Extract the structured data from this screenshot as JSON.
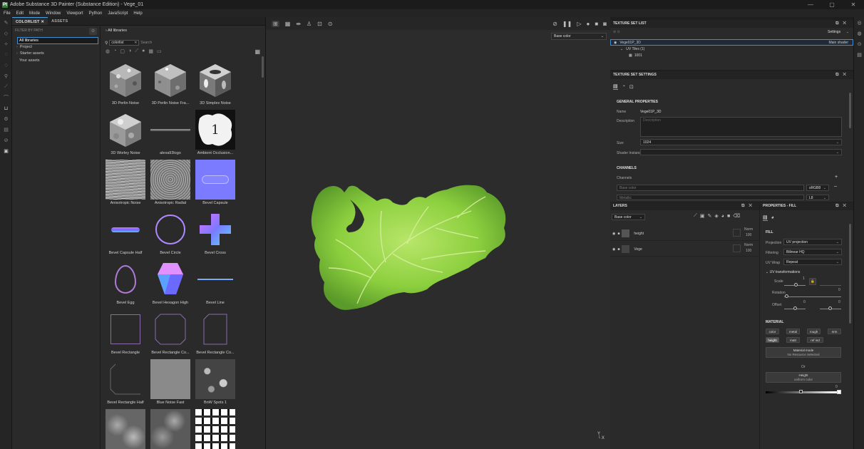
{
  "window": {
    "title": "Adobe Substance 3D Painter (Substance Edition) - Vege_01",
    "logo": "Pt",
    "controls": [
      "—",
      "▢",
      "✕"
    ]
  },
  "menu": [
    "File",
    "Edit",
    "Mode",
    "Window",
    "Viewport",
    "Python",
    "JavaScript",
    "Help"
  ],
  "shelf": {
    "tabs": [
      "COLORLIST",
      "ASSETS"
    ],
    "tab_close": "✕",
    "filter_header": "FILTER BY PATH",
    "paths": [
      {
        "label": "All libraries",
        "selected": true
      },
      {
        "label": "Project",
        "caret": "›"
      },
      {
        "label": "Starter assets",
        "caret": "›"
      },
      {
        "label": "Your assets"
      }
    ],
    "breadcrumb": "All libraries",
    "search_value": "colorlist",
    "search_placeholder": "Search",
    "assets": [
      "3D Perlin Noise",
      "3D Perlin Noise Fra...",
      "3D Simplex Noise",
      "3D Worley Noise",
      "alexa93logo",
      "Ambient Occlusion...",
      "Anisotropic Noise",
      "Anisotropic Radial",
      "Bevel Capsule",
      "Bevel Capsule Half",
      "Bevel Circle",
      "Bevel Cross",
      "Bevel Egg",
      "Bevel Hexagon High",
      "Bevel Line",
      "Bevel Rectangle",
      "Bevel Rectangle Co...",
      "Bevel Rectangle Co...",
      "Bevel Rectangle Half",
      "Blue Noise Fast",
      "BnW Spots 1",
      "",
      "",
      ""
    ]
  },
  "viewport": {
    "channel": "Base color",
    "axis": "Y\nZ —X"
  },
  "texture_set_list": {
    "header": "TEXTURE SET LIST",
    "settings": "Settings",
    "set_name": "Vege01P_3D",
    "shader": "Main shader",
    "uv_tiles": "UV Tiles (1)",
    "tile": "1001"
  },
  "texture_set_settings": {
    "header": "TEXTURE SET SETTINGS",
    "general": "GENERAL PROPERTIES",
    "name_label": "Name",
    "name_value": "Vege01P_3D",
    "desc_label": "Description",
    "desc_placeholder": "Description",
    "size_label": "Size",
    "size_value": "1024",
    "shader_label": "Shader Instance",
    "channels": "CHANNELS",
    "channels_label": "Channels",
    "ch1": "Base color",
    "ch1_fmt": "sRGB8",
    "ch2": "Metallic",
    "ch2_fmt": "L8"
  },
  "layers": {
    "header": "LAYERS",
    "channel": "Base color",
    "items": [
      {
        "name": "height",
        "blend": "Norm",
        "opacity": "100"
      },
      {
        "name": "Vege",
        "blend": "Norm",
        "opacity": "100"
      }
    ]
  },
  "properties": {
    "header": "PROPERTIES - FILL",
    "fill": "FILL",
    "projection_label": "Projection",
    "projection": "UV projection",
    "filtering_label": "Filtering",
    "filtering": "Bilinear HQ",
    "uvwrap_label": "UV Wrap",
    "uvwrap": "Repeat",
    "uvtrans": "UV transformations",
    "scale_label": "Scale",
    "scale_val": "1",
    "rotation_label": "Rotation",
    "rotation_val": "0",
    "offset_label": "Offset",
    "offset_x": "0",
    "offset_y": "0",
    "material": "MATERIAL",
    "mat_buttons": [
      "color",
      "metal",
      "rough",
      "nrm",
      "height",
      "matt",
      "ref ind"
    ],
    "mat_mode": "Material mode",
    "mat_mode_val": "No Resource Selected",
    "or": "Or",
    "height_label": "Height",
    "height_sub": "uniform color",
    "height_val": "0"
  }
}
